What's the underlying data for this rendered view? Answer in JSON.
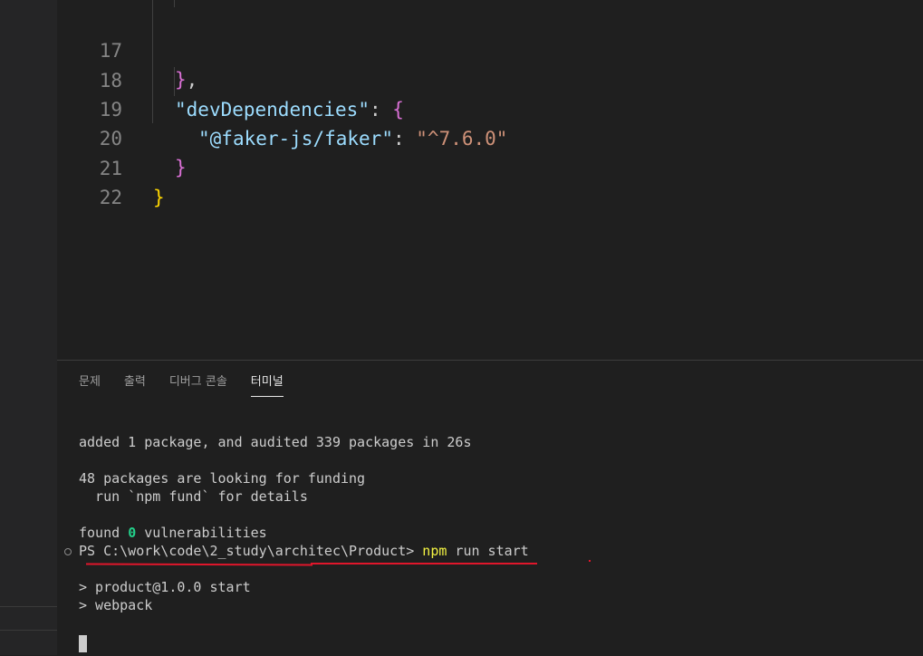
{
  "editor": {
    "lines": [
      {
        "num": "17"
      },
      {
        "num": "18",
        "key": "devDependencies"
      },
      {
        "num": "19",
        "key": "@faker-js/faker",
        "value": "^7.6.0"
      },
      {
        "num": "20"
      },
      {
        "num": "21"
      },
      {
        "num": "22"
      }
    ]
  },
  "panel": {
    "tabs": [
      {
        "label": "문제",
        "active": false
      },
      {
        "label": "출력",
        "active": false
      },
      {
        "label": "디버그 콘솔",
        "active": false
      },
      {
        "label": "터미널",
        "active": true
      }
    ]
  },
  "terminal": {
    "line1": "added 1 package, and audited 339 packages in 26s",
    "line2": "48 packages are looking for funding",
    "line3": "  run `npm fund` for details",
    "line4_pre": "found ",
    "line4_num": "0",
    "line4_post": " vulnerabilities",
    "prompt": "PS C:\\work\\code\\2_study\\architec\\Product> ",
    "command_npm": "npm",
    "command_rest": " run start",
    "out1": "> product@1.0.0 start",
    "out2": "> webpack"
  },
  "colors": {
    "background": "#1f1f1f",
    "annotation_underline": "#e0162b",
    "success_green": "#23d18b",
    "command_yellow": "#f5f543"
  }
}
